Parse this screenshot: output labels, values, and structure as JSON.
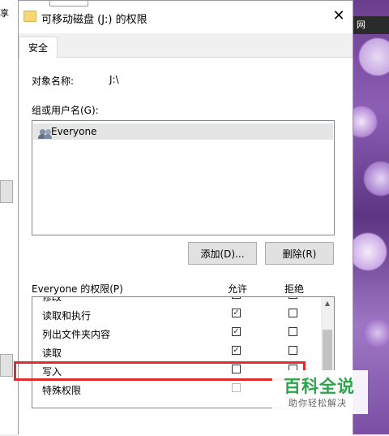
{
  "window": {
    "title": "可移动磁盘 (J:) 的权限",
    "close_symbol": "✕"
  },
  "tab": {
    "label": "安全"
  },
  "object": {
    "label": "对象名称:",
    "value": "J:\\"
  },
  "users": {
    "label": "组或用户名(G):",
    "items": [
      "Everyone"
    ]
  },
  "buttons": {
    "add": "添加(D)...",
    "remove": "删除(R)"
  },
  "permissions": {
    "header": "Everyone 的权限(P)",
    "allow_header": "允许",
    "deny_header": "拒绝",
    "rows": [
      {
        "name": "修改",
        "allow": false,
        "deny": false
      },
      {
        "name": "读取和执行",
        "allow": true,
        "deny": false
      },
      {
        "name": "列出文件夹内容",
        "allow": true,
        "deny": false
      },
      {
        "name": "读取",
        "allow": true,
        "deny": false
      },
      {
        "name": "写入",
        "allow": false,
        "deny": false
      },
      {
        "name": "特殊权限",
        "allow": false,
        "deny": false
      }
    ]
  },
  "background": {
    "left_label": "享",
    "right_label": "网"
  },
  "watermark": {
    "title": "百科全说",
    "subtitle": "助你轻松解决"
  }
}
